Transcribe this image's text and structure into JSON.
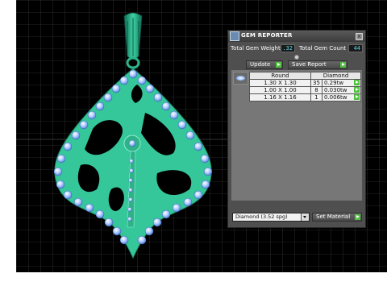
{
  "gem_reporter": {
    "title": "GEM REPORTER",
    "close_glyph": "x",
    "total_weight_label": "Total Gem Weight",
    "total_weight_value": ".32",
    "total_count_label": "Total Gem Count",
    "total_count_value": "44",
    "update_label": "Update",
    "save_report_label": "Save Report",
    "table": {
      "headers": [
        "Round",
        "Diamond"
      ],
      "rows": [
        {
          "size": "1.30 X 1.30",
          "count": "35",
          "weight": "0.29tw"
        },
        {
          "size": "1.00 X 1.00",
          "count": "8",
          "weight": "0.030tw"
        },
        {
          "size": "1.16 X 1.16",
          "count": "1",
          "weight": "0.006tw"
        }
      ]
    },
    "material_select": "Diamond   (3.52 spg)",
    "set_material_label": "Set Material"
  },
  "icons": {
    "panel_icon": "gem-reporter-icon",
    "go_icon": "play-arrow-icon",
    "gem_icon": "round-gem-icon"
  },
  "colors": {
    "viewport_bg": "#000000",
    "grid": "#4a4a4a",
    "pendant_green": "#35c79a",
    "gem_blue": "#a8c8ff",
    "value_text": "#5bd9e8",
    "go_button": "#4cc23a"
  }
}
